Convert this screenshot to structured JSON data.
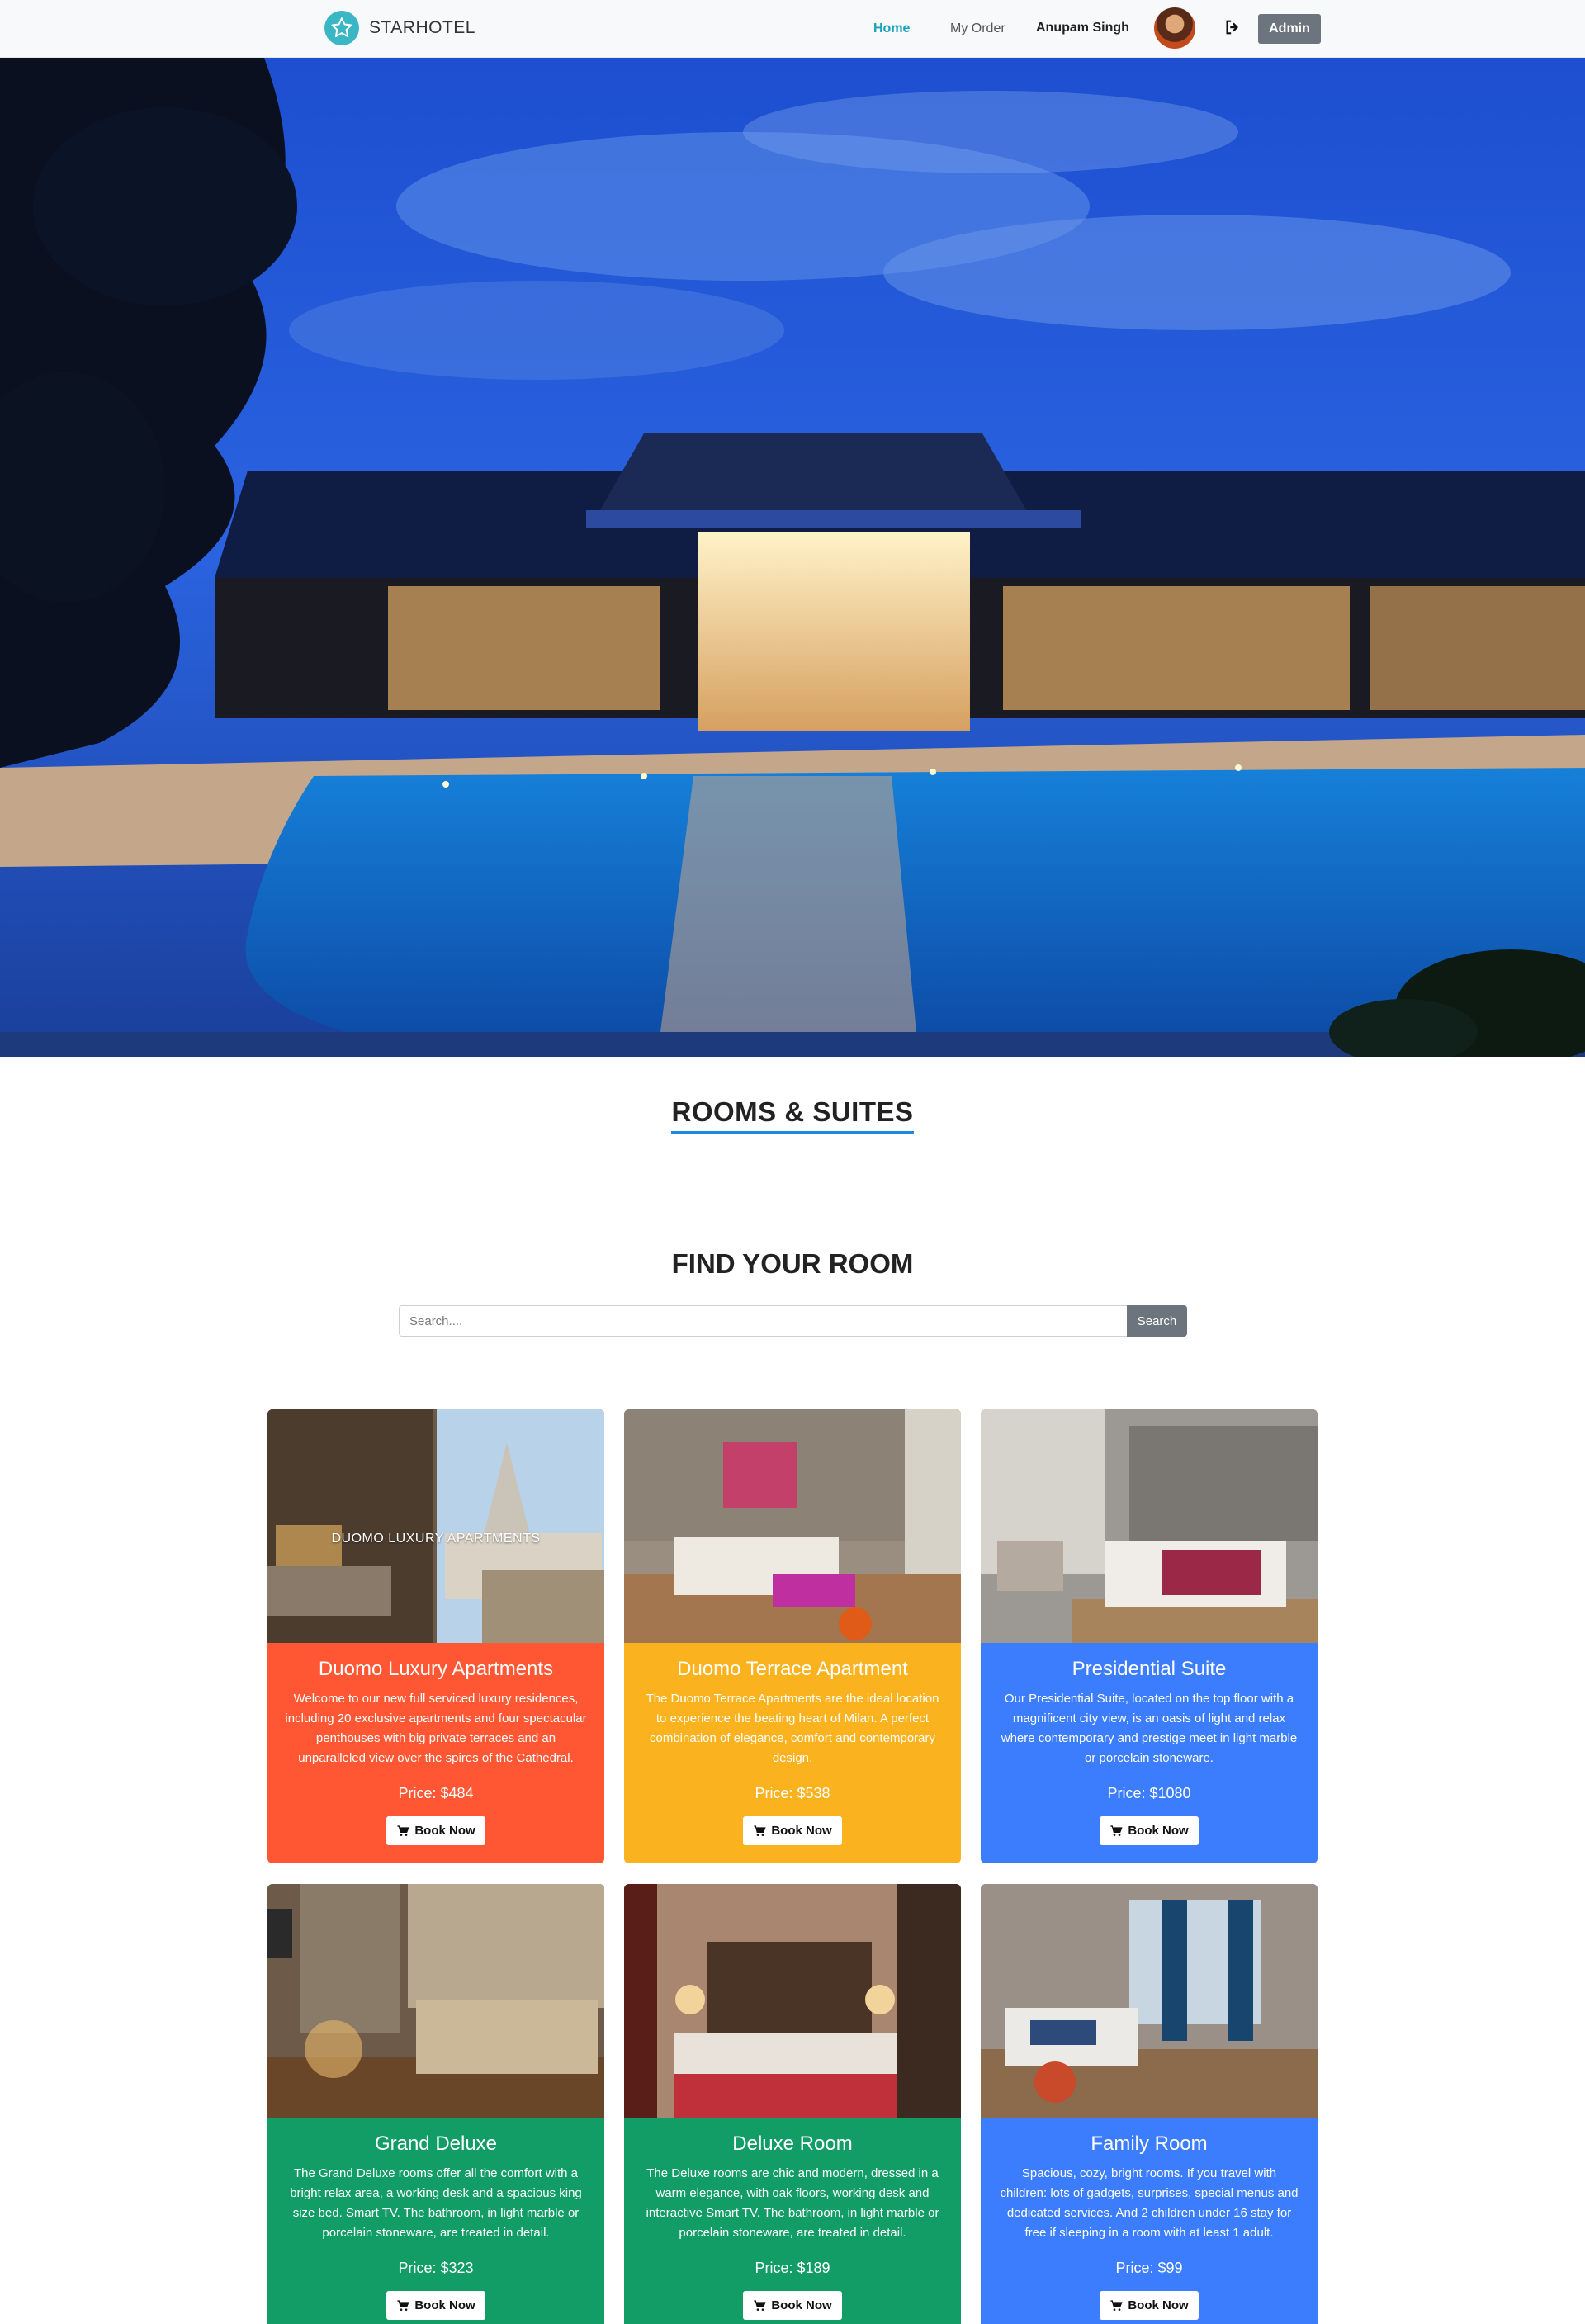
{
  "nav": {
    "brand": "STARHOTEL",
    "home": "Home",
    "my_order": "My Order",
    "user_name": "Anupam Singh",
    "admin": "Admin"
  },
  "rooms_title": "ROOMS & SUITES",
  "find_title": "FIND YOUR ROOM",
  "search": {
    "placeholder": "Search....",
    "button": "Search"
  },
  "rooms": [
    {
      "name": "Duomo Luxury Apartments",
      "image_caption": "DUOMO LUXURY APARTMENTS",
      "description": "Welcome to our new full serviced luxury residences, including 20 exclusive apartments and four spectacular penthouses with big private terraces and an unparalleled view over the spires of the Cathedral.",
      "price": "Price: $484",
      "button": "Book Now",
      "color": "#ff5733"
    },
    {
      "name": "Duomo Terrace Apartment",
      "description": "The Duomo Terrace Apartments are the ideal location to experience the beating heart of Milan. A perfect combination of elegance, comfort and contemporary design.",
      "price": "Price: $538",
      "button": "Book Now",
      "color": "#fbb21f"
    },
    {
      "name": "Presidential Suite",
      "description": "Our Presidential Suite, located on the top floor with a magnificent city view, is an oasis of light and relax where contemporary and prestige meet in light marble or porcelain stoneware.",
      "price": "Price: $1080",
      "button": "Book Now",
      "color": "#3b7dfd"
    },
    {
      "name": "Grand Deluxe",
      "description": "The Grand Deluxe rooms offer all the comfort with a bright relax area, a working desk and a spacious king size bed. Smart TV. The bathroom, in light marble or porcelain stoneware, are treated in detail.",
      "price": "Price: $323",
      "button": "Book Now",
      "color": "#129d66"
    },
    {
      "name": "Deluxe Room",
      "description": "The Deluxe rooms are chic and modern, dressed in a warm elegance, with oak floors, working desk and interactive Smart TV. The bathroom, in light marble or porcelain stoneware, are treated in detail.",
      "price": "Price: $189",
      "button": "Book Now",
      "color": "#129d66"
    },
    {
      "name": "Family Room",
      "description": "Spacious, cozy, bright rooms. If you travel with children: lots of gadgets, surprises, special menus and dedicated services. And 2 children under 16 stay for free if sleeping in a room with at least 1 adult.",
      "price": "Price: $99",
      "button": "Book Now",
      "color": "#3b7dfd"
    }
  ]
}
